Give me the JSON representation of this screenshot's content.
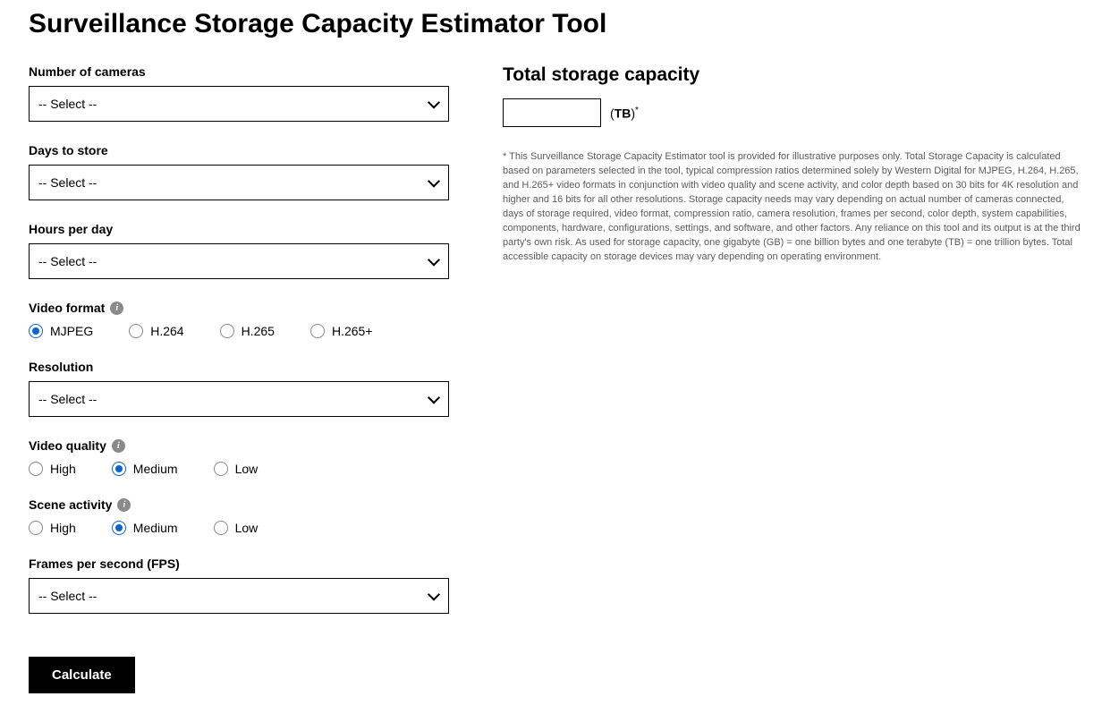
{
  "title": "Surveillance Storage Capacity Estimator Tool",
  "form": {
    "select_placeholder": "-- Select --",
    "num_cameras": {
      "label": "Number of cameras"
    },
    "days_store": {
      "label": "Days to store"
    },
    "hours_day": {
      "label": "Hours per day"
    },
    "video_format": {
      "label": "Video format",
      "selected": "MJPEG",
      "options": [
        "MJPEG",
        "H.264",
        "H.265",
        "H.265+"
      ]
    },
    "resolution": {
      "label": "Resolution"
    },
    "video_quality": {
      "label": "Video quality",
      "selected": "Medium",
      "options": [
        "High",
        "Medium",
        "Low"
      ]
    },
    "scene_activity": {
      "label": "Scene activity",
      "selected": "Medium",
      "options": [
        "High",
        "Medium",
        "Low"
      ]
    },
    "fps": {
      "label": "Frames per second (FPS)"
    },
    "calculate_button": "Calculate"
  },
  "result": {
    "title": "Total storage capacity",
    "value": "",
    "unit_prefix": "(",
    "unit_bold": "TB",
    "unit_suffix": ")",
    "star": "*"
  },
  "disclaimer": "* This Surveillance Storage Capacity Estimator tool is provided for illustrative purposes only. Total Storage Capacity is calculated based on parameters selected in the tool, typical compression ratios determined solely by Western Digital for MJPEG, H.264, H.265, and H.265+ video formats in conjunction with video quality and scene activity, and color depth based on 30 bits for 4K resolution and higher and 16 bits for all other resolutions. Storage capacity needs may vary depending on actual number of cameras connected, days of storage required, video format, compression ratio, camera resolution, frames per second, color depth, system capabilities, components, hardware, configurations, settings, and software, and other factors. Any reliance on this tool and its output is at the third party's own risk. As used for storage capacity, one gigabyte (GB) = one billion bytes and one terabyte (TB) = one trillion bytes. Total accessible capacity on storage devices may vary depending on operating environment."
}
